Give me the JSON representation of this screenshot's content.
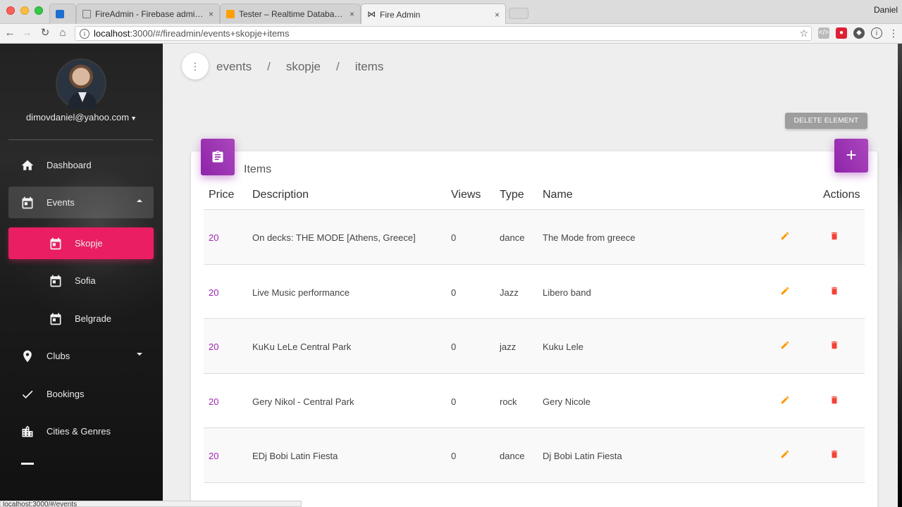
{
  "browser": {
    "tabs": [
      {
        "title": "",
        "icon": "trello-icon"
      },
      {
        "title": "FireAdmin - Firebase admin pa",
        "icon": "page-icon"
      },
      {
        "title": "Tester – Realtime Database – F",
        "icon": "firebase-icon"
      },
      {
        "title": "Fire Admin",
        "icon": "bowtie-icon"
      }
    ],
    "close_glyph": "×",
    "profile_name": "Daniel",
    "url_host": "localhost",
    "url_rest": ":3000/#/fireadmin/events+skopje+items",
    "status_url": "localhost:3000/#/events"
  },
  "sidebar": {
    "user_email": "dimovdaniel@yahoo.com",
    "items": [
      {
        "label": "Dashboard",
        "icon": "home-icon"
      },
      {
        "label": "Events",
        "icon": "calendar-icon",
        "expanded": true
      },
      {
        "label": "Skopje",
        "icon": "calendar-icon",
        "active": true
      },
      {
        "label": "Sofia",
        "icon": "calendar-icon"
      },
      {
        "label": "Belgrade",
        "icon": "calendar-icon"
      },
      {
        "label": "Clubs",
        "icon": "location-pin-icon"
      },
      {
        "label": "Bookings",
        "icon": "check-icon"
      },
      {
        "label": "Cities & Genres",
        "icon": "city-icon"
      }
    ]
  },
  "breadcrumb": {
    "items": [
      "events",
      "skopje",
      "items"
    ],
    "separator": "/"
  },
  "actions": {
    "delete_element": "DELETE ELEMENT",
    "add": "+"
  },
  "card": {
    "title": "Items",
    "columns": [
      "Price",
      "Description",
      "Views",
      "Type",
      "Name",
      "Actions"
    ],
    "rows": [
      {
        "price": "20",
        "description": "On decks: THE MODE [Athens, Greece]",
        "views": "0",
        "type": "dance",
        "name": "The Mode from greece"
      },
      {
        "price": "20",
        "description": "Live Music performance",
        "views": "0",
        "type": "Jazz",
        "name": "Libero band"
      },
      {
        "price": "20",
        "description": "KuKu LeLe Central Park",
        "views": "0",
        "type": "jazz",
        "name": "Kuku Lele"
      },
      {
        "price": "20",
        "description": "Gery Nikol - Central Park",
        "views": "0",
        "type": "rock",
        "name": "Gery Nicole"
      },
      {
        "price": "20",
        "description": "EDj Bobi Latin Fiesta",
        "views": "0",
        "type": "dance",
        "name": "Dj Bobi Latin Fiesta"
      }
    ]
  },
  "colors": {
    "accent_purple": "#9c27b0",
    "active_pink": "#e91e63",
    "edit_orange": "#ff9800",
    "delete_red": "#f44336"
  }
}
